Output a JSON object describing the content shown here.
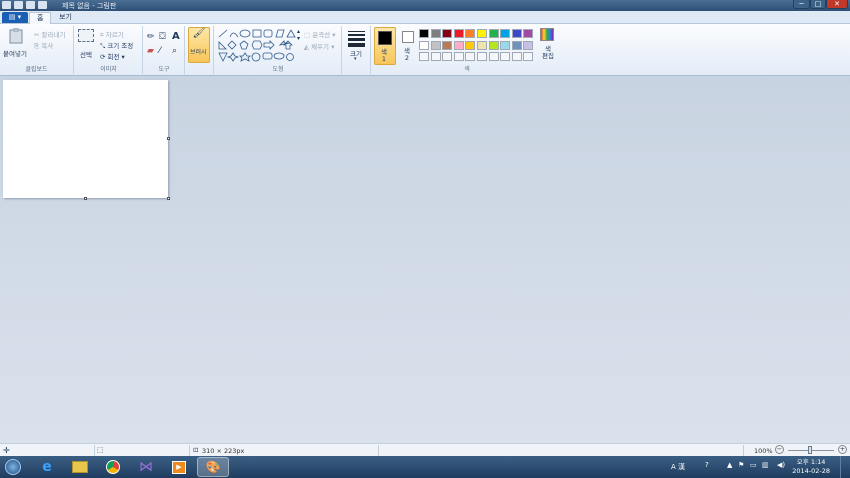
{
  "window": {
    "title": "제목 없음 - 그림판",
    "minimize": "─",
    "maximize": "□",
    "close": "✕"
  },
  "tabs": [
    {
      "label": "홈"
    },
    {
      "label": "보기"
    }
  ],
  "ribbon": {
    "clipboard": {
      "label": "클립보드",
      "paste": "붙여넣기",
      "cut": "잘라내기",
      "copy": "복사"
    },
    "image": {
      "label": "이미지",
      "select": "선택",
      "crop": "자르기",
      "resize": "크기 조정",
      "rotate": "회전"
    },
    "tools": {
      "label": "도구"
    },
    "brushes": {
      "label": "브러시"
    },
    "shapes": {
      "label": "도형",
      "outline": "윤곽선",
      "fill": "채우기"
    },
    "size": {
      "label": "크기"
    },
    "colors": {
      "label": "색",
      "color1": "색\n1",
      "color2": "색\n2",
      "edit": "색\n편집",
      "color1_value": "#000000",
      "color2_value": "#ffffff",
      "palette_row1": [
        "#000000",
        "#7f7f7f",
        "#880015",
        "#ed1c24",
        "#ff7f27",
        "#fff200",
        "#22b14c",
        "#00a2e8",
        "#3f48cc",
        "#a349a4"
      ],
      "palette_row2": [
        "#ffffff",
        "#c3c3c3",
        "#b97a57",
        "#ffaec9",
        "#ffc90e",
        "#efe4b0",
        "#b5e61d",
        "#99d9ea",
        "#7092be",
        "#c8bfe7"
      ]
    }
  },
  "status": {
    "canvas_size": "310 × 223px",
    "zoom": "100%"
  },
  "taskbar": {
    "time": "오후 1:14",
    "date": "2014-02-28",
    "ime": "A 漢"
  }
}
